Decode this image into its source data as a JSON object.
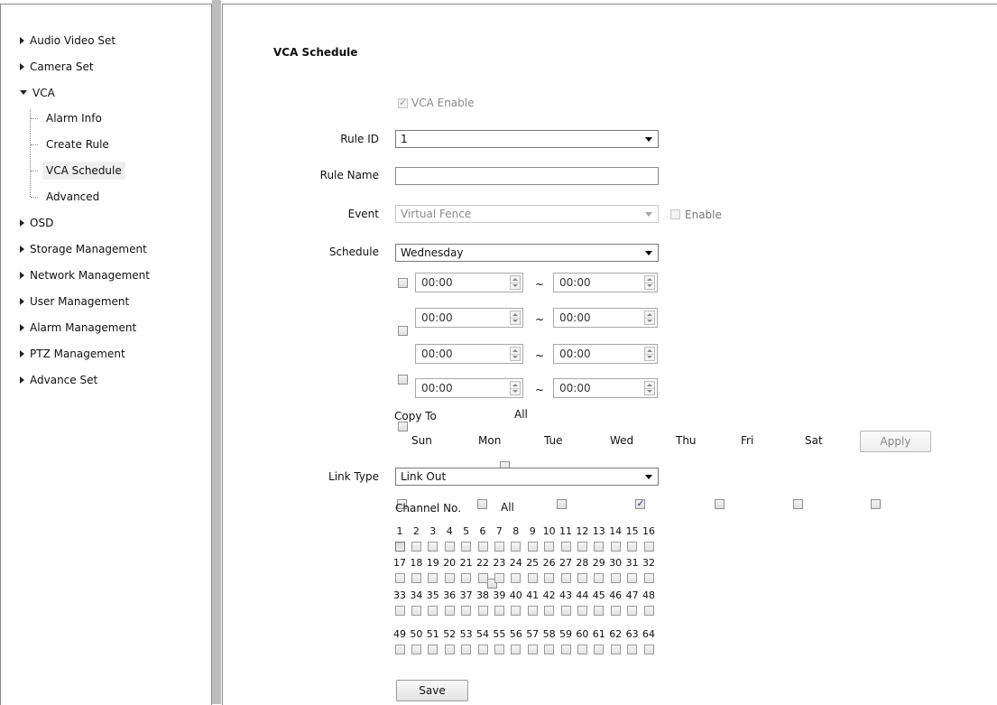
{
  "sidebar": {
    "items": [
      {
        "label": "Audio Video Set",
        "expanded": false
      },
      {
        "label": "Camera Set",
        "expanded": false
      },
      {
        "label": "VCA",
        "expanded": true
      },
      {
        "label": "OSD",
        "expanded": false
      },
      {
        "label": "Storage Management",
        "expanded": false
      },
      {
        "label": "Network Management",
        "expanded": false
      },
      {
        "label": "User Management",
        "expanded": false
      },
      {
        "label": "Alarm Management",
        "expanded": false
      },
      {
        "label": "PTZ Management",
        "expanded": false
      },
      {
        "label": "Advance Set",
        "expanded": false
      }
    ],
    "vca_children": [
      {
        "label": "Alarm Info",
        "selected": false
      },
      {
        "label": "Create Rule",
        "selected": false
      },
      {
        "label": "VCA Schedule",
        "selected": true
      },
      {
        "label": "Advanced",
        "selected": false
      }
    ]
  },
  "form": {
    "title": "VCA Schedule",
    "vca_enable": {
      "label": "VCA Enable",
      "checked": true,
      "disabled": true
    },
    "rule_id": {
      "label": "Rule ID",
      "value": "1"
    },
    "rule_name": {
      "label": "Rule Name",
      "value": ""
    },
    "event": {
      "label": "Event",
      "value": "Virtual Fence",
      "enable_label": "Enable",
      "enable_checked": false
    },
    "schedule": {
      "label": "Schedule",
      "value": "Wednesday",
      "periods": [
        {
          "checked": false,
          "start": "00:00",
          "end": "00:00"
        },
        {
          "checked": false,
          "start": "00:00",
          "end": "00:00"
        },
        {
          "checked": false,
          "start": "00:00",
          "end": "00:00"
        },
        {
          "checked": false,
          "start": "00:00",
          "end": "00:00"
        }
      ],
      "separator": "~"
    },
    "copy_to": {
      "label": "Copy To",
      "all_label": "All",
      "days": [
        {
          "label": "Sun",
          "checked": false
        },
        {
          "label": "Mon",
          "checked": false
        },
        {
          "label": "Tue",
          "checked": false
        },
        {
          "label": "Wed",
          "checked": true
        },
        {
          "label": "Thu",
          "checked": false
        },
        {
          "label": "Fri",
          "checked": false
        },
        {
          "label": "Sat",
          "checked": false
        }
      ],
      "apply_label": "Apply"
    },
    "link_type": {
      "label": "Link Type",
      "value": "Link Out"
    },
    "channels": {
      "label": "Channel No.",
      "all_label": "All",
      "rows": [
        [
          "1",
          "2",
          "3",
          "4",
          "5",
          "6",
          "7",
          "8",
          "9",
          "10",
          "11",
          "12",
          "13",
          "14",
          "15",
          "16"
        ],
        [
          "17",
          "18",
          "19",
          "20",
          "21",
          "22",
          "23",
          "24",
          "25",
          "26",
          "27",
          "28",
          "29",
          "30",
          "31",
          "32"
        ],
        [
          "33",
          "34",
          "35",
          "36",
          "37",
          "38",
          "39",
          "40",
          "41",
          "42",
          "43",
          "44",
          "45",
          "46",
          "47",
          "48"
        ],
        [
          "49",
          "50",
          "51",
          "52",
          "53",
          "54",
          "55",
          "56",
          "57",
          "58",
          "59",
          "60",
          "61",
          "62",
          "63",
          "64"
        ]
      ]
    },
    "save_label": "Save"
  }
}
